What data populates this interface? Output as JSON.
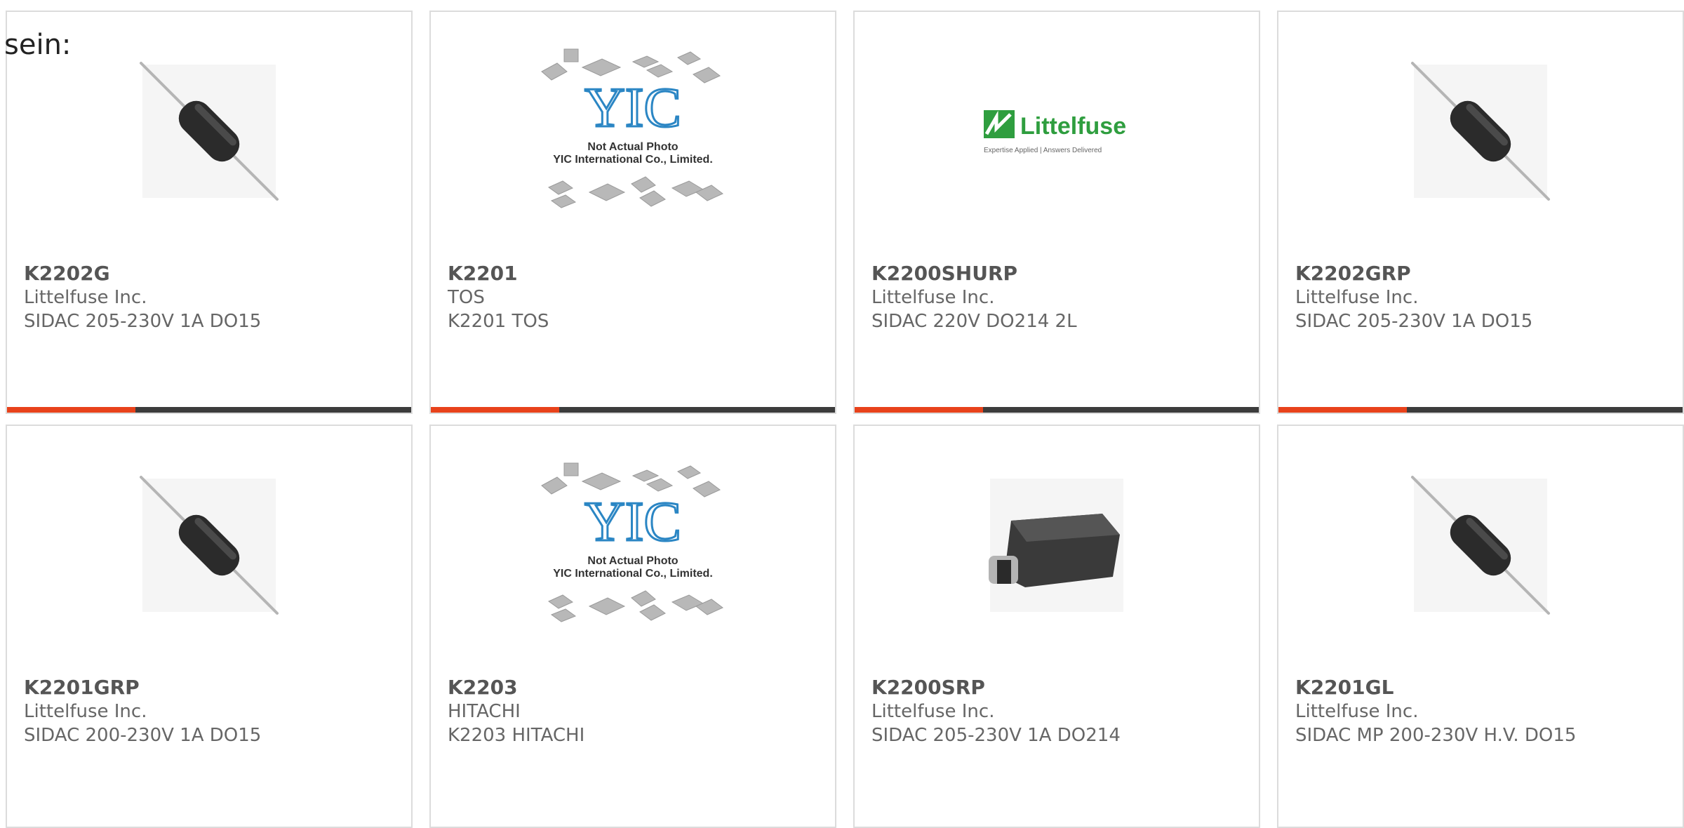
{
  "intro_text": "sein:",
  "colors": {
    "accent": "#e8421b",
    "bar_dark": "#3c3c3c",
    "card_border": "#dcdcdc",
    "littelfuse_green": "#2f9e3f",
    "yic_blue": "#2b86c4"
  },
  "yic_placeholder": {
    "brand": "YIC",
    "line1": "Not Actual Photo",
    "line2": "YIC International Co., Limited."
  },
  "littelfuse_logo": {
    "brand": "Littelfuse",
    "tagline": "Expertise Applied | Answers Delivered"
  },
  "products": [
    {
      "part": "K2202G",
      "manufacturer": "Littelfuse Inc.",
      "description": "SIDAC 205-230V 1A DO15",
      "image": "axial-diode"
    },
    {
      "part": "K2201",
      "manufacturer": "TOS",
      "description": "K2201 TOS",
      "image": "yic-placeholder"
    },
    {
      "part": "K2200SHURP",
      "manufacturer": "Littelfuse Inc.",
      "description": "SIDAC 220V DO214 2L",
      "image": "littelfuse-logo"
    },
    {
      "part": "K2202GRP",
      "manufacturer": "Littelfuse Inc.",
      "description": "SIDAC 205-230V 1A DO15",
      "image": "axial-diode"
    },
    {
      "part": "K2201GRP",
      "manufacturer": "Littelfuse Inc.",
      "description": "SIDAC 200-230V 1A DO15",
      "image": "axial-diode"
    },
    {
      "part": "K2203",
      "manufacturer": "HITACHI",
      "description": "K2203 HITACHI",
      "image": "yic-placeholder"
    },
    {
      "part": "K2200SRP",
      "manufacturer": "Littelfuse Inc.",
      "description": "SIDAC 205-230V 1A DO214",
      "image": "smd-package"
    },
    {
      "part": "K2201GL",
      "manufacturer": "Littelfuse Inc.",
      "description": "SIDAC MP 200-230V H.V. DO15",
      "image": "axial-diode"
    }
  ]
}
